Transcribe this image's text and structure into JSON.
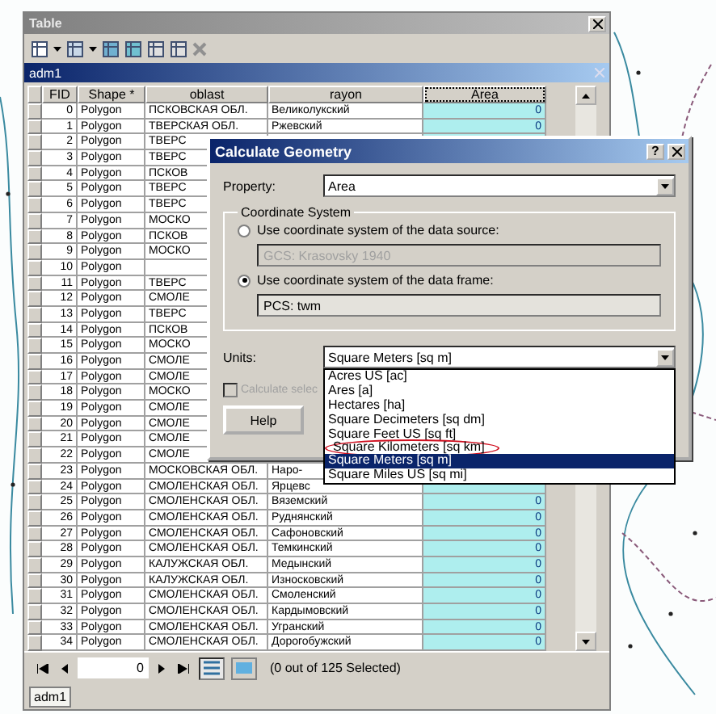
{
  "table_window": {
    "title": "Table",
    "layer_title": "adm1",
    "columns": [
      {
        "label": "FID",
        "selected": false
      },
      {
        "label": "Shape *",
        "selected": false
      },
      {
        "label": "oblast",
        "selected": false
      },
      {
        "label": "rayon",
        "selected": false
      },
      {
        "label": "Area",
        "selected": true
      }
    ],
    "rows": [
      {
        "fid": "0",
        "shape": "Polygon",
        "oblast": "ПСКОВСКАЯ ОБЛ.",
        "rayon": "Великолукский",
        "area": "0"
      },
      {
        "fid": "1",
        "shape": "Polygon",
        "oblast": "ТВЕРСКАЯ ОБЛ.",
        "rayon": "Ржевский",
        "area": "0"
      },
      {
        "fid": "2",
        "shape": "Polygon",
        "oblast": "ТВЕРС"
      },
      {
        "fid": "3",
        "shape": "Polygon",
        "oblast": "ТВЕРС"
      },
      {
        "fid": "4",
        "shape": "Polygon",
        "oblast": "ПСКОВ"
      },
      {
        "fid": "5",
        "shape": "Polygon",
        "oblast": "ТВЕРС"
      },
      {
        "fid": "6",
        "shape": "Polygon",
        "oblast": "ТВЕРС"
      },
      {
        "fid": "7",
        "shape": "Polygon",
        "oblast": "МОСКО"
      },
      {
        "fid": "8",
        "shape": "Polygon",
        "oblast": "ПСКОВ"
      },
      {
        "fid": "9",
        "shape": "Polygon",
        "oblast": "МОСКО"
      },
      {
        "fid": "10",
        "shape": "Polygon"
      },
      {
        "fid": "11",
        "shape": "Polygon",
        "oblast": "ТВЕРС"
      },
      {
        "fid": "12",
        "shape": "Polygon",
        "oblast": "СМОЛЕ"
      },
      {
        "fid": "13",
        "shape": "Polygon",
        "oblast": "ТВЕРС"
      },
      {
        "fid": "14",
        "shape": "Polygon",
        "oblast": "ПСКОВ"
      },
      {
        "fid": "15",
        "shape": "Polygon",
        "oblast": "МОСКО"
      },
      {
        "fid": "16",
        "shape": "Polygon",
        "oblast": "СМОЛЕ"
      },
      {
        "fid": "17",
        "shape": "Polygon",
        "oblast": "СМОЛЕ"
      },
      {
        "fid": "18",
        "shape": "Polygon",
        "oblast": "МОСКО"
      },
      {
        "fid": "19",
        "shape": "Polygon",
        "oblast": "СМОЛЕ"
      },
      {
        "fid": "20",
        "shape": "Polygon",
        "oblast": "СМОЛЕ"
      },
      {
        "fid": "21",
        "shape": "Polygon",
        "oblast": "СМОЛЕ"
      },
      {
        "fid": "22",
        "shape": "Polygon",
        "oblast": "СМОЛЕ"
      },
      {
        "fid": "23",
        "shape": "Polygon",
        "oblast": "МОСКОВСКАЯ ОБЛ.",
        "rayon": "Наро-"
      },
      {
        "fid": "24",
        "shape": "Polygon",
        "oblast": "СМОЛЕНСКАЯ ОБЛ.",
        "rayon": "Ярцевс"
      },
      {
        "fid": "25",
        "shape": "Polygon",
        "oblast": "СМОЛЕНСКАЯ ОБЛ.",
        "rayon": "Вяземский",
        "area": "0"
      },
      {
        "fid": "26",
        "shape": "Polygon",
        "oblast": "СМОЛЕНСКАЯ ОБЛ.",
        "rayon": "Руднянский",
        "area": "0"
      },
      {
        "fid": "27",
        "shape": "Polygon",
        "oblast": "СМОЛЕНСКАЯ ОБЛ.",
        "rayon": "Сафоновский",
        "area": "0"
      },
      {
        "fid": "28",
        "shape": "Polygon",
        "oblast": "СМОЛЕНСКАЯ ОБЛ.",
        "rayon": "Темкинский",
        "area": "0"
      },
      {
        "fid": "29",
        "shape": "Polygon",
        "oblast": "КАЛУЖСКАЯ ОБЛ.",
        "rayon": "Медынский",
        "area": "0"
      },
      {
        "fid": "30",
        "shape": "Polygon",
        "oblast": "КАЛУЖСКАЯ ОБЛ.",
        "rayon": "Износковский",
        "area": "0"
      },
      {
        "fid": "31",
        "shape": "Polygon",
        "oblast": "СМОЛЕНСКАЯ ОБЛ.",
        "rayon": "Смоленский",
        "area": "0"
      },
      {
        "fid": "32",
        "shape": "Polygon",
        "oblast": "СМОЛЕНСКАЯ ОБЛ.",
        "rayon": "Кардымовский",
        "area": "0"
      },
      {
        "fid": "33",
        "shape": "Polygon",
        "oblast": "СМОЛЕНСКАЯ ОБЛ.",
        "rayon": "Угранский",
        "area": "0"
      },
      {
        "fid": "34",
        "shape": "Polygon",
        "oblast": "СМОЛЕНСКАЯ ОБЛ.",
        "rayon": "Дорогобужский",
        "area": "0"
      }
    ],
    "navigator": {
      "record": "0",
      "status": "(0 out of 125 Selected)"
    },
    "bottom_tab": "adm1"
  },
  "dialog": {
    "title": "Calculate Geometry",
    "help_mark": "?",
    "property": {
      "label": "Property:",
      "value": "Area"
    },
    "coordinate_system": {
      "legend": "Coordinate System",
      "options": [
        {
          "label": "Use coordinate system of the data source:",
          "value": "GCS: Krasovsky 1940",
          "selected": false
        },
        {
          "label": "Use coordinate system of the data frame:",
          "value": "PCS: twm",
          "selected": true
        }
      ]
    },
    "units": {
      "label": "Units:",
      "value": "Square Meters [sq m]",
      "options": [
        {
          "label": "Acres US [ac]",
          "selected": false,
          "circled": false
        },
        {
          "label": "Ares [a]",
          "selected": false,
          "circled": false
        },
        {
          "label": "Hectares [ha]",
          "selected": false,
          "circled": false
        },
        {
          "label": "Square Decimeters [sq dm]",
          "selected": false,
          "circled": false
        },
        {
          "label": "Square Feet US [sq ft]",
          "selected": false,
          "circled": false
        },
        {
          "label": "Square Kilometers [sq km]",
          "selected": false,
          "circled": true
        },
        {
          "label": "Square Meters [sq m]",
          "selected": true,
          "circled": false
        },
        {
          "label": "Square Miles US [sq mi]",
          "selected": false,
          "circled": false
        }
      ]
    },
    "calculate_selected": {
      "label": "Calculate selec",
      "checked": false,
      "disabled": true
    },
    "buttons": [
      "Help"
    ]
  }
}
